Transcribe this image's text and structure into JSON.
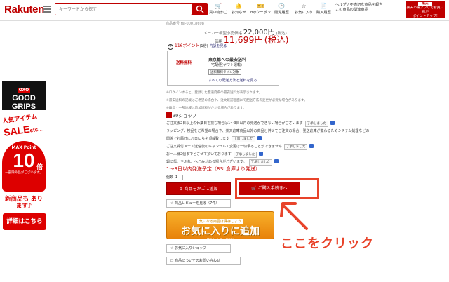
{
  "header": {
    "logo": "Rakuten",
    "search_placeholder": "キーワードから探す",
    "nav": [
      {
        "label": "買い物かご",
        "icon": "cart-icon"
      },
      {
        "label": "お知らせ",
        "icon": "bell-icon"
      },
      {
        "label": "myクーポン",
        "icon": "coupon-icon"
      },
      {
        "label": "閲覧履歴",
        "icon": "history-icon"
      },
      {
        "label": "お気に入り",
        "icon": "star-icon"
      },
      {
        "label": "購入履歴",
        "icon": "receipt-icon"
      }
    ],
    "help_line1": "ヘルプ / 不適切な商品を報告",
    "help_line2": "この商品の関連商品",
    "promo_line1": "楽天",
    "promo_line2": "楽天市場アプリでお買い物が",
    "promo_line3": "ポイントアップ!"
  },
  "left_banner": {
    "oxo_brand": "OXO",
    "oxo_title": "GOOD GRIPS",
    "sale_line1": "人気アイテム",
    "sale_line2": "SALE",
    "sale_etc": "etc...",
    "point_label": "MAX Point",
    "point_value": "10",
    "point_unit": "倍",
    "point_note": "一部除外品がございます。",
    "new_items": "新商品も あります♪",
    "detail": "詳細はこちら"
  },
  "product": {
    "sku": "商品番号 rsl-00018698",
    "msrp_label": "メーカー希望小売価格",
    "msrp_value": "22,000円",
    "msrp_tax": "(税込)",
    "price_label": "価格",
    "price_value": "11,699円",
    "price_tax": "(税込)",
    "points": "116ポイント",
    "points_note": "(1倍)",
    "points_link": "内訳を見る",
    "shipping_label": "送料無料",
    "shipping_title": "東京都への最安送料",
    "shipping_method": "宅配便(ヤマト運輸)",
    "shipping_tag": "送料無料ライン対象",
    "shipping_link": "すべての配送方法と送料を見る",
    "notes": [
      "※ログインすると、登録した都道府県の最安送料が表示されます。",
      "※最安送料の記載はご希望の場合や、注文確認画面にて配送方法の変更が必要な場合があります。",
      "※離島・一部地域は追加送料がかかる場合があります。"
    ],
    "shop_name": "39ショップ",
    "conditions": [
      {
        "text": "ご注文後2日以上の休業日を挟む場合は1〜3日以内の発送ができない場合がございます",
        "agree": "了承しました"
      },
      {
        "text": "ラッピング、検品をご希望の場合や、楽天倉庫商品以外の商品と併せてご注文の場合、発送倉庫が変わるためシステム処理などの",
        "agree": ""
      },
      {
        "text": "関係でお届けにお日にちを頂載致します",
        "agree": "了承しました"
      },
      {
        "text": "ご注文受付メール送信後のキャンセル・変更は一切承ることができません",
        "agree": "了承しました"
      },
      {
        "text": "お一人様2個までとさせて頂いております",
        "agree": "了承しました"
      },
      {
        "text": "鍋に傷、やぶれ、へこみがある場合がございます。",
        "agree": "了承しました"
      }
    ],
    "delivery": "1〜3日以内発送予定（RSL倉庫より発送）",
    "qty_label": "個数",
    "qty_value": "1",
    "add_to_cart": "商品をかごに追加",
    "buy_now": "ご購入手続きへ",
    "review": "商品レビューを見る（7件）",
    "fav_banner_top": "気になる商品は保存しよう",
    "fav_banner_main": "お気に入りに追加",
    "fav_banner_sub": "使うとすごく便利!!",
    "fav_list": "お気に入りショップ",
    "inquiry": "商品についてのお問い合わせ"
  },
  "annotation": {
    "text": "ここをクリック",
    "color": "#e8432a"
  }
}
